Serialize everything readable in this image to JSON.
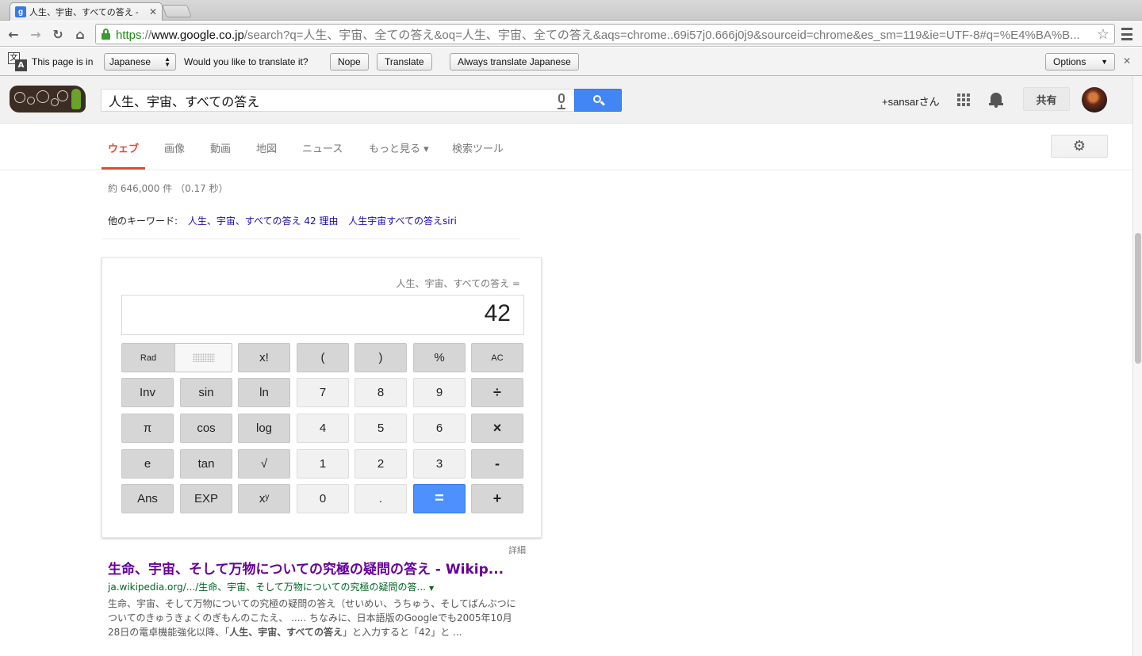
{
  "browser": {
    "tab_title": "人生、宇宙、すべての答え - ",
    "tab_favicon": "g",
    "url_scheme": "https",
    "url_host": "www.google.co.jp",
    "url_rest": "/search?q=人生、宇宙、全ての答え&oq=人生、宇宙、全ての答え&aqs=chrome..69i57j0.666j0j9&sourceid=chrome&es_sm=119&ie=UTF-8#q=%E4%BA%B..."
  },
  "translate_bar": {
    "prefix": "This page is in",
    "language": "Japanese",
    "question": "Would you like to translate it?",
    "nope": "Nope",
    "translate": "Translate",
    "always": "Always translate Japanese",
    "options": "Options"
  },
  "header": {
    "query": "人生、宇宙、すべての答え",
    "user_name": "+sansarさん",
    "share_label": "共有"
  },
  "tabs": [
    {
      "label": "ウェブ",
      "active": true
    },
    {
      "label": "画像"
    },
    {
      "label": "動画"
    },
    {
      "label": "地図"
    },
    {
      "label": "ニュース"
    },
    {
      "label": "もっと見る ▾"
    },
    {
      "label": "検索ツール"
    }
  ],
  "stats": "約 646,000 件 （0.17 秒）",
  "related": {
    "label": "他のキーワード:",
    "links": [
      "人生、宇宙、すべての答え 42 理由",
      "人生宇宙すべての答えsiri"
    ]
  },
  "calculator": {
    "expression": "人生、宇宙、すべての答え =",
    "display": "42",
    "mode": "Rad",
    "buttons": [
      [
        "x!",
        "(",
        ")",
        "%",
        "AC"
      ],
      [
        "Inv",
        "sin",
        "ln",
        "7",
        "8",
        "9",
        "÷"
      ],
      [
        "π",
        "cos",
        "log",
        "4",
        "5",
        "6",
        "×"
      ],
      [
        "e",
        "tan",
        "√",
        "1",
        "2",
        "3",
        "-"
      ],
      [
        "Ans",
        "EXP",
        "xʸ",
        "0",
        ".",
        "=",
        "+"
      ]
    ],
    "details": "詳細"
  },
  "result": {
    "title": "生命、宇宙、そして万物についての究極の疑問の答え - Wikip...",
    "url": "ja.wikipedia.org/.../生命、宇宙、そして万物についての究極の疑問の答...",
    "snippet_1": "生命、宇宙、そして万物についての究極の疑問の答え（せいめい、うちゅう、そしてばんぶつについてのきゅうきょくのぎもんのこたえ、 ..... ちなみに、日本語版のGoogleでも2005年10月28日の電卓機能強化以降、「",
    "snippet_bold": "人生、宇宙、すべての答え",
    "snippet_2": "」と入力すると「42」と ..."
  },
  "colors": {
    "active_tab": "#dd4b39",
    "search_button": "#4285f4",
    "link": "#1a0dab",
    "visited": "#660099",
    "url_green": "#006621",
    "equals_button": "#4d90fe"
  }
}
